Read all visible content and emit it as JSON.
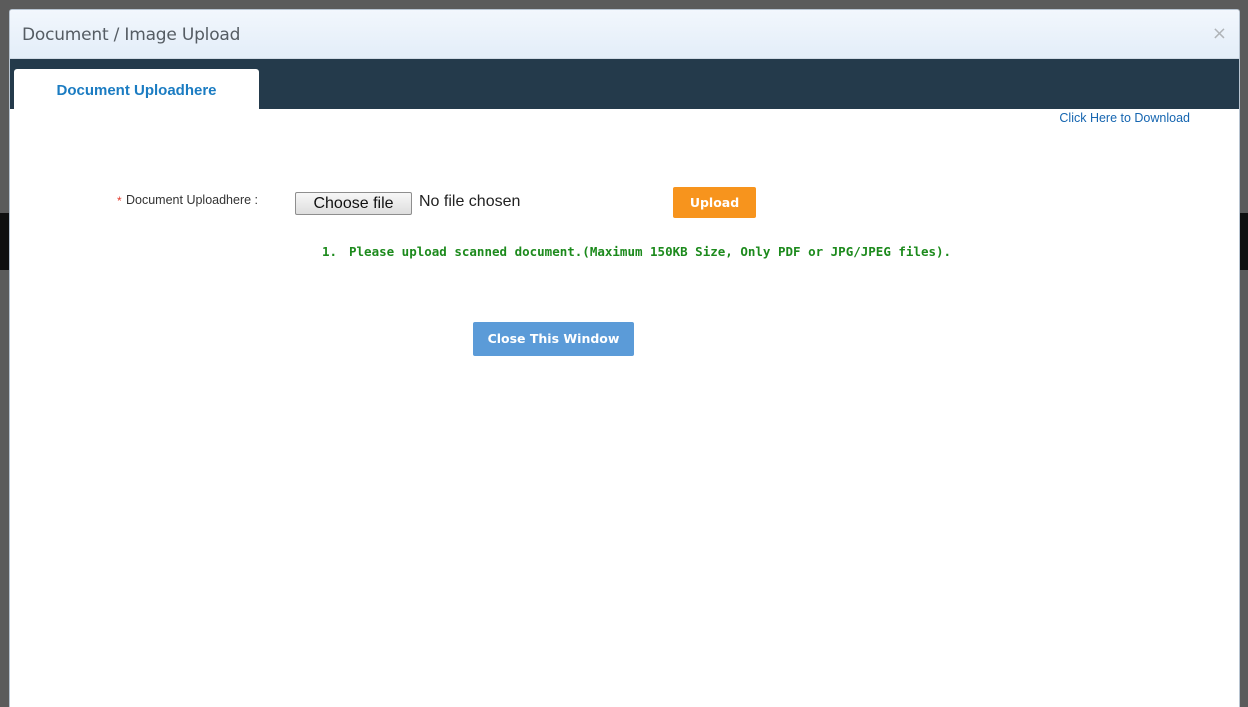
{
  "dialog": {
    "title": "Document / Image Upload",
    "close_glyph": "×"
  },
  "tabs": [
    {
      "label": "Document Uploadhere",
      "active": true
    }
  ],
  "download_link": "Click Here to Download",
  "upload_form": {
    "required_mark": "*",
    "field_label": "Document Uploadhere :",
    "choose_file_label": "Choose file",
    "file_status": "No file chosen",
    "upload_button_label": "Upload"
  },
  "notes": [
    {
      "number": "1.",
      "text": "Please upload scanned document.(Maximum 150KB Size, Only PDF or JPG/JPEG files)."
    }
  ],
  "close_window_button_label": "Close This Window",
  "colors": {
    "tab_bar": "#243a4b",
    "tab_label": "#1b7cc2",
    "upload_button": "#f7941d",
    "close_window_button": "#5b9bd8",
    "note_text": "#1c8a1c",
    "required_mark": "#e23b2c"
  }
}
